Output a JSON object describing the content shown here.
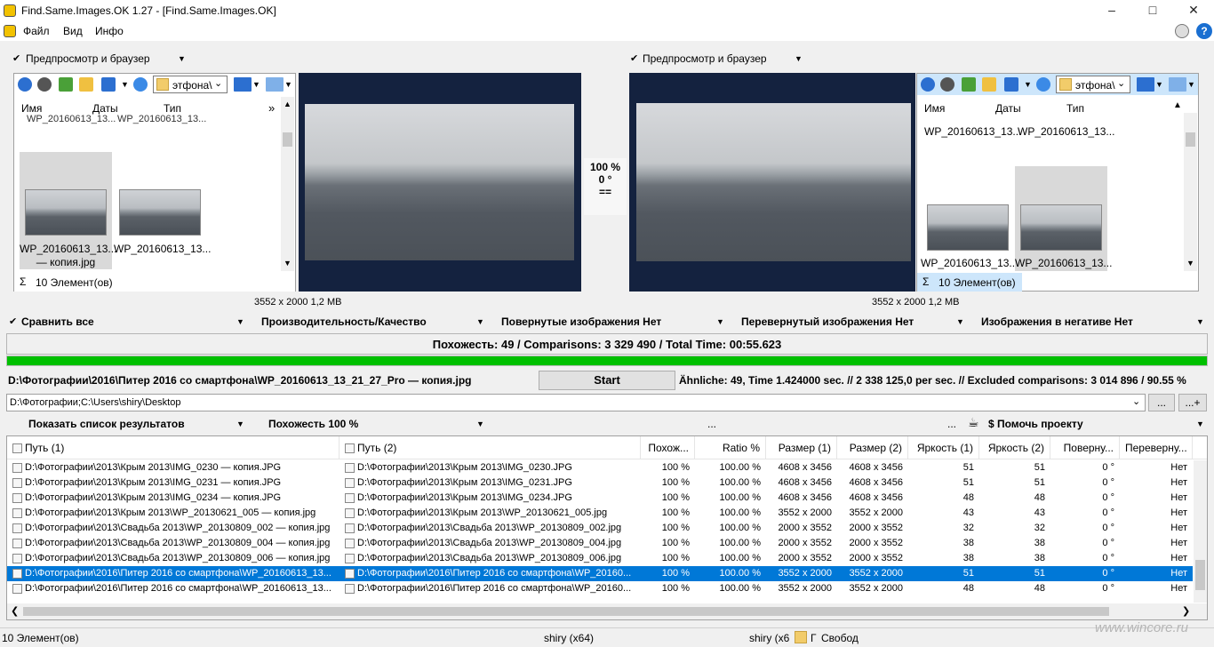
{
  "window": {
    "title": "Find.Same.Images.OK 1.27 - [Find.Same.Images.OK]"
  },
  "menu": {
    "file": "Файл",
    "view": "Вид",
    "info": "Инфо"
  },
  "left_panel": {
    "header": "Предпросмотр и браузер",
    "path_box": "этфона\\",
    "columns": [
      "Имя",
      "Даты",
      "Тип"
    ],
    "top_items": [
      "WP_20160613_13...",
      "WP_20160613_13..."
    ],
    "thumbs": [
      {
        "caption1": "WP_20160613_13...",
        "caption2": "— копия.jpg"
      },
      {
        "caption1": "WP_20160613_13...",
        "caption2": ""
      }
    ],
    "count": "10 Элемент(ов)",
    "dims": "3552 x 2000 1,2 MB"
  },
  "right_panel": {
    "header": "Предпросмотр и браузер",
    "path_box": "этфона\\",
    "columns": [
      "Имя",
      "Даты",
      "Тип"
    ],
    "top_items": [
      "WP_20160613_13...",
      "WP_20160613_13..."
    ],
    "thumbs": [
      {
        "caption1": "WP_20160613_13..."
      },
      {
        "caption1": "WP_20160613_13..."
      }
    ],
    "count": "10 Элемент(ов)",
    "dims": "3552 x 2000 1,2 MB"
  },
  "compare_info": {
    "percent": "100 %",
    "angle": "0 °",
    "eq": "=="
  },
  "options": {
    "compare_all": "Сравнить все",
    "performance": "Производительность/Качество",
    "rotated": "Повернутые изображения Нет",
    "flipped": "Перевернутый изображения Нет",
    "negative": "Изображения в негативе Нет"
  },
  "summary": "Похожесть: 49 / Comparisons: 3 329 490 / Total Time: 00:55.623",
  "progress": 1.0,
  "current_file": "D:\\Фотографии\\2016\\Питер 2016 со смартфона\\WP_20160613_13_21_27_Pro — копия.jpg",
  "start_button": "Start",
  "stats_line": "Ähnliche: 49, Time 1.424000 sec. // 2 338 125,0 per sec. // Excluded comparisons: 3 014 896 / 90.55 %",
  "search_paths": "D:\\Фотографии;C:\\Users\\shiry\\Desktop",
  "browse_btn": "...",
  "add_btn": "...+",
  "results_bar": {
    "show_list": "Показать список результатов",
    "similarity": "Похожесть 100 %",
    "dots": "...",
    "dots2": "...",
    "help": "$ Помочь проекту"
  },
  "table": {
    "headers": [
      "Путь (1)",
      "Путь (2)",
      "Похож...",
      "Ratio %",
      "Размер (1)",
      "Размер (2)",
      "Яркость (1)",
      "Яркость (2)",
      "Поверну...",
      "Переверну..."
    ],
    "rows": [
      [
        "D:\\Фотографии\\2013\\Крым 2013\\IMG_0230 — копия.JPG",
        "D:\\Фотографии\\2013\\Крым 2013\\IMG_0230.JPG",
        "100 %",
        "100.00 %",
        "4608 x 3456",
        "4608 x 3456",
        "51",
        "51",
        "0 °",
        "Нет"
      ],
      [
        "D:\\Фотографии\\2013\\Крым 2013\\IMG_0231 — копия.JPG",
        "D:\\Фотографии\\2013\\Крым 2013\\IMG_0231.JPG",
        "100 %",
        "100.00 %",
        "4608 x 3456",
        "4608 x 3456",
        "51",
        "51",
        "0 °",
        "Нет"
      ],
      [
        "D:\\Фотографии\\2013\\Крым 2013\\IMG_0234 — копия.JPG",
        "D:\\Фотографии\\2013\\Крым 2013\\IMG_0234.JPG",
        "100 %",
        "100.00 %",
        "4608 x 3456",
        "4608 x 3456",
        "48",
        "48",
        "0 °",
        "Нет"
      ],
      [
        "D:\\Фотографии\\2013\\Крым 2013\\WP_20130621_005 — копия.jpg",
        "D:\\Фотографии\\2013\\Крым 2013\\WP_20130621_005.jpg",
        "100 %",
        "100.00 %",
        "3552 x 2000",
        "3552 x 2000",
        "43",
        "43",
        "0 °",
        "Нет"
      ],
      [
        "D:\\Фотографии\\2013\\Свадьба 2013\\WP_20130809_002 — копия.jpg",
        "D:\\Фотографии\\2013\\Свадьба 2013\\WP_20130809_002.jpg",
        "100 %",
        "100.00 %",
        "2000 x 3552",
        "2000 x 3552",
        "32",
        "32",
        "0 °",
        "Нет"
      ],
      [
        "D:\\Фотографии\\2013\\Свадьба 2013\\WP_20130809_004 — копия.jpg",
        "D:\\Фотографии\\2013\\Свадьба 2013\\WP_20130809_004.jpg",
        "100 %",
        "100.00 %",
        "2000 x 3552",
        "2000 x 3552",
        "38",
        "38",
        "0 °",
        "Нет"
      ],
      [
        "D:\\Фотографии\\2013\\Свадьба 2013\\WP_20130809_006 — копия.jpg",
        "D:\\Фотографии\\2013\\Свадьба 2013\\WP_20130809_006.jpg",
        "100 %",
        "100.00 %",
        "2000 x 3552",
        "2000 x 3552",
        "38",
        "38",
        "0 °",
        "Нет"
      ],
      [
        "D:\\Фотографии\\2016\\Питер 2016 со смартфона\\WP_20160613_13...",
        "D:\\Фотографии\\2016\\Питер 2016 со смартфона\\WP_20160...",
        "100 %",
        "100.00 %",
        "3552 x 2000",
        "3552 x 2000",
        "51",
        "51",
        "0 °",
        "Нет"
      ],
      [
        "D:\\Фотографии\\2016\\Питер 2016 со смартфона\\WP_20160613_13...",
        "D:\\Фотографии\\2016\\Питер 2016 со смартфона\\WP_20160...",
        "100 %",
        "100.00 %",
        "3552 x 2000",
        "3552 x 2000",
        "48",
        "48",
        "0 °",
        "Нет"
      ]
    ],
    "selected_row": 7
  },
  "statusbar": {
    "count": "10 Элемент(ов)",
    "user": "shiry (x64)",
    "user2": "shiry (x6",
    "free": "Свобод",
    "watermark": "www.wincore.ru"
  },
  "colors": {
    "accent": "#0078d7",
    "progress": "#00c000",
    "preview_bg": "#14223f"
  }
}
